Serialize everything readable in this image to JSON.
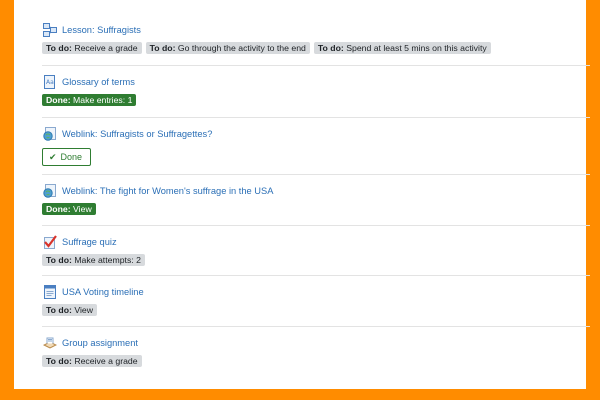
{
  "activities": [
    {
      "title": "Lesson: Suffragists",
      "icon": "lesson-icon",
      "badges": [
        {
          "type": "todo",
          "label": "To do:",
          "text": "Receive a grade"
        },
        {
          "type": "todo",
          "label": "To do:",
          "text": "Go through the activity to the end"
        },
        {
          "type": "todo",
          "label": "To do:",
          "text": "Spend at least 5 mins on this activity"
        }
      ]
    },
    {
      "title": "Glossary of terms",
      "icon": "glossary-icon",
      "badges": [
        {
          "type": "done",
          "label": "Done:",
          "text": "Make entries: 1"
        }
      ]
    },
    {
      "title": "Weblink: Suffragists or Suffragettes?",
      "icon": "globe-icon",
      "done_button": "Done"
    },
    {
      "title": "Weblink: The fight for Women's suffrage in the USA",
      "icon": "globe-icon",
      "badges": [
        {
          "type": "done",
          "label": "Done:",
          "text": "View"
        }
      ]
    },
    {
      "title": "Suffrage quiz",
      "icon": "quiz-icon",
      "badges": [
        {
          "type": "todo",
          "label": "To do:",
          "text": "Make attempts: 2"
        }
      ]
    },
    {
      "title": "USA Voting timeline",
      "icon": "page-icon",
      "badges": [
        {
          "type": "todo",
          "label": "To do:",
          "text": "View"
        }
      ]
    },
    {
      "title": "Group assignment",
      "icon": "assignment-icon",
      "badges": [
        {
          "type": "todo",
          "label": "To do:",
          "text": "Receive a grade"
        }
      ]
    }
  ],
  "colors": {
    "border": "#ff8c00",
    "link": "#2b6fb6",
    "done": "#2f7d32",
    "todo": "#d7dadd"
  }
}
